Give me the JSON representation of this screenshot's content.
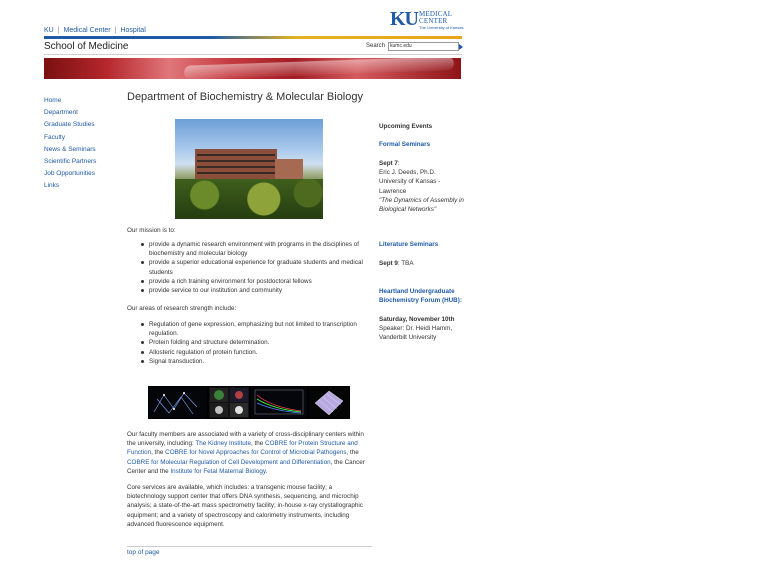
{
  "top_links": [
    "KU",
    "Medical Center",
    "Hospital"
  ],
  "logo": {
    "ku": "KU",
    "line1": "MEDICAL",
    "line2": "CENTER",
    "line3": "The University of Kansas"
  },
  "header": {
    "school": "School of Medicine",
    "search_label": "Search",
    "search_value": "kumc.edu"
  },
  "nav": [
    "Home",
    "Department",
    "Graduate Studies",
    "Faculty",
    "News & Seminars",
    "Scientific Partners",
    "Job Opportunities",
    "Links"
  ],
  "main": {
    "title": "Department of Biochemistry & Molecular Biology",
    "mission_heading": "Our mission is to:",
    "mission": [
      "provide a dynamic research environment with programs in the disciplines of biochemistry and molecular biology",
      "provide a superior educational experience for graduate students and medical students",
      "provide a rich training environment for postdoctoral fellows",
      "provide service to our institution and community"
    ],
    "areas_heading": "Our areas of research strength include:",
    "areas": [
      "Regulation of gene expression, emphasizing but not limited to transcription regulation.",
      "Protein folding and structure determination.",
      "Allosteric regulation of protein function.",
      "Signal transduction."
    ],
    "faculty": {
      "t1": "Our faculty members are associated with a variety of cross-disciplinary centers within the university, including: ",
      "l1": "The Kidney Institute",
      "t2": ", the ",
      "l2": "COBRE for Protein Structure and Function",
      "t3": ", the ",
      "l3": "COBRE for Novel Approaches for Control of Microbial Pathogens",
      "t4": ", the ",
      "l4": "COBRE for Molecular Regulation of Cell Development and Differentiation",
      "t5": ", the Cancer Center and the ",
      "l5": "Institute for Fetal Maternal Biology",
      "t6": "."
    },
    "core": "Core services are available, which includes: a transgenic mouse facility; a biotechnology support center that offers DNA synthesis, sequencing, and microchip analysis; a state-of-the-art mass spectrometry facility; in-house x-ray crystallographic equipment; and a variety of spectroscopy and calorimetry instruments, including advanced fluorescence equipment.",
    "top_link": "top of page"
  },
  "events": {
    "heading": "Upcoming Events",
    "formal": "Formal Seminars",
    "formal_date": "Sept 7",
    "formal_colon": ":",
    "formal_speaker": "Eric J. Deeds, Ph.D.",
    "formal_affil": "University of Kansas - Lawrence",
    "formal_title": "\"The Dynamics of Assembly in Biological Networks\"",
    "lit": "Literature Seminars",
    "lit_date": "Sept 9",
    "lit_value": ": TBA",
    "hub": "Heartland Undergraduate Biochemistry Forum (HUB):",
    "hub_date": "Saturday, November 10th",
    "hub_speaker": "Speaker: Dr. Heidi Hamm,",
    "hub_affil": "Vanderbilt University"
  }
}
